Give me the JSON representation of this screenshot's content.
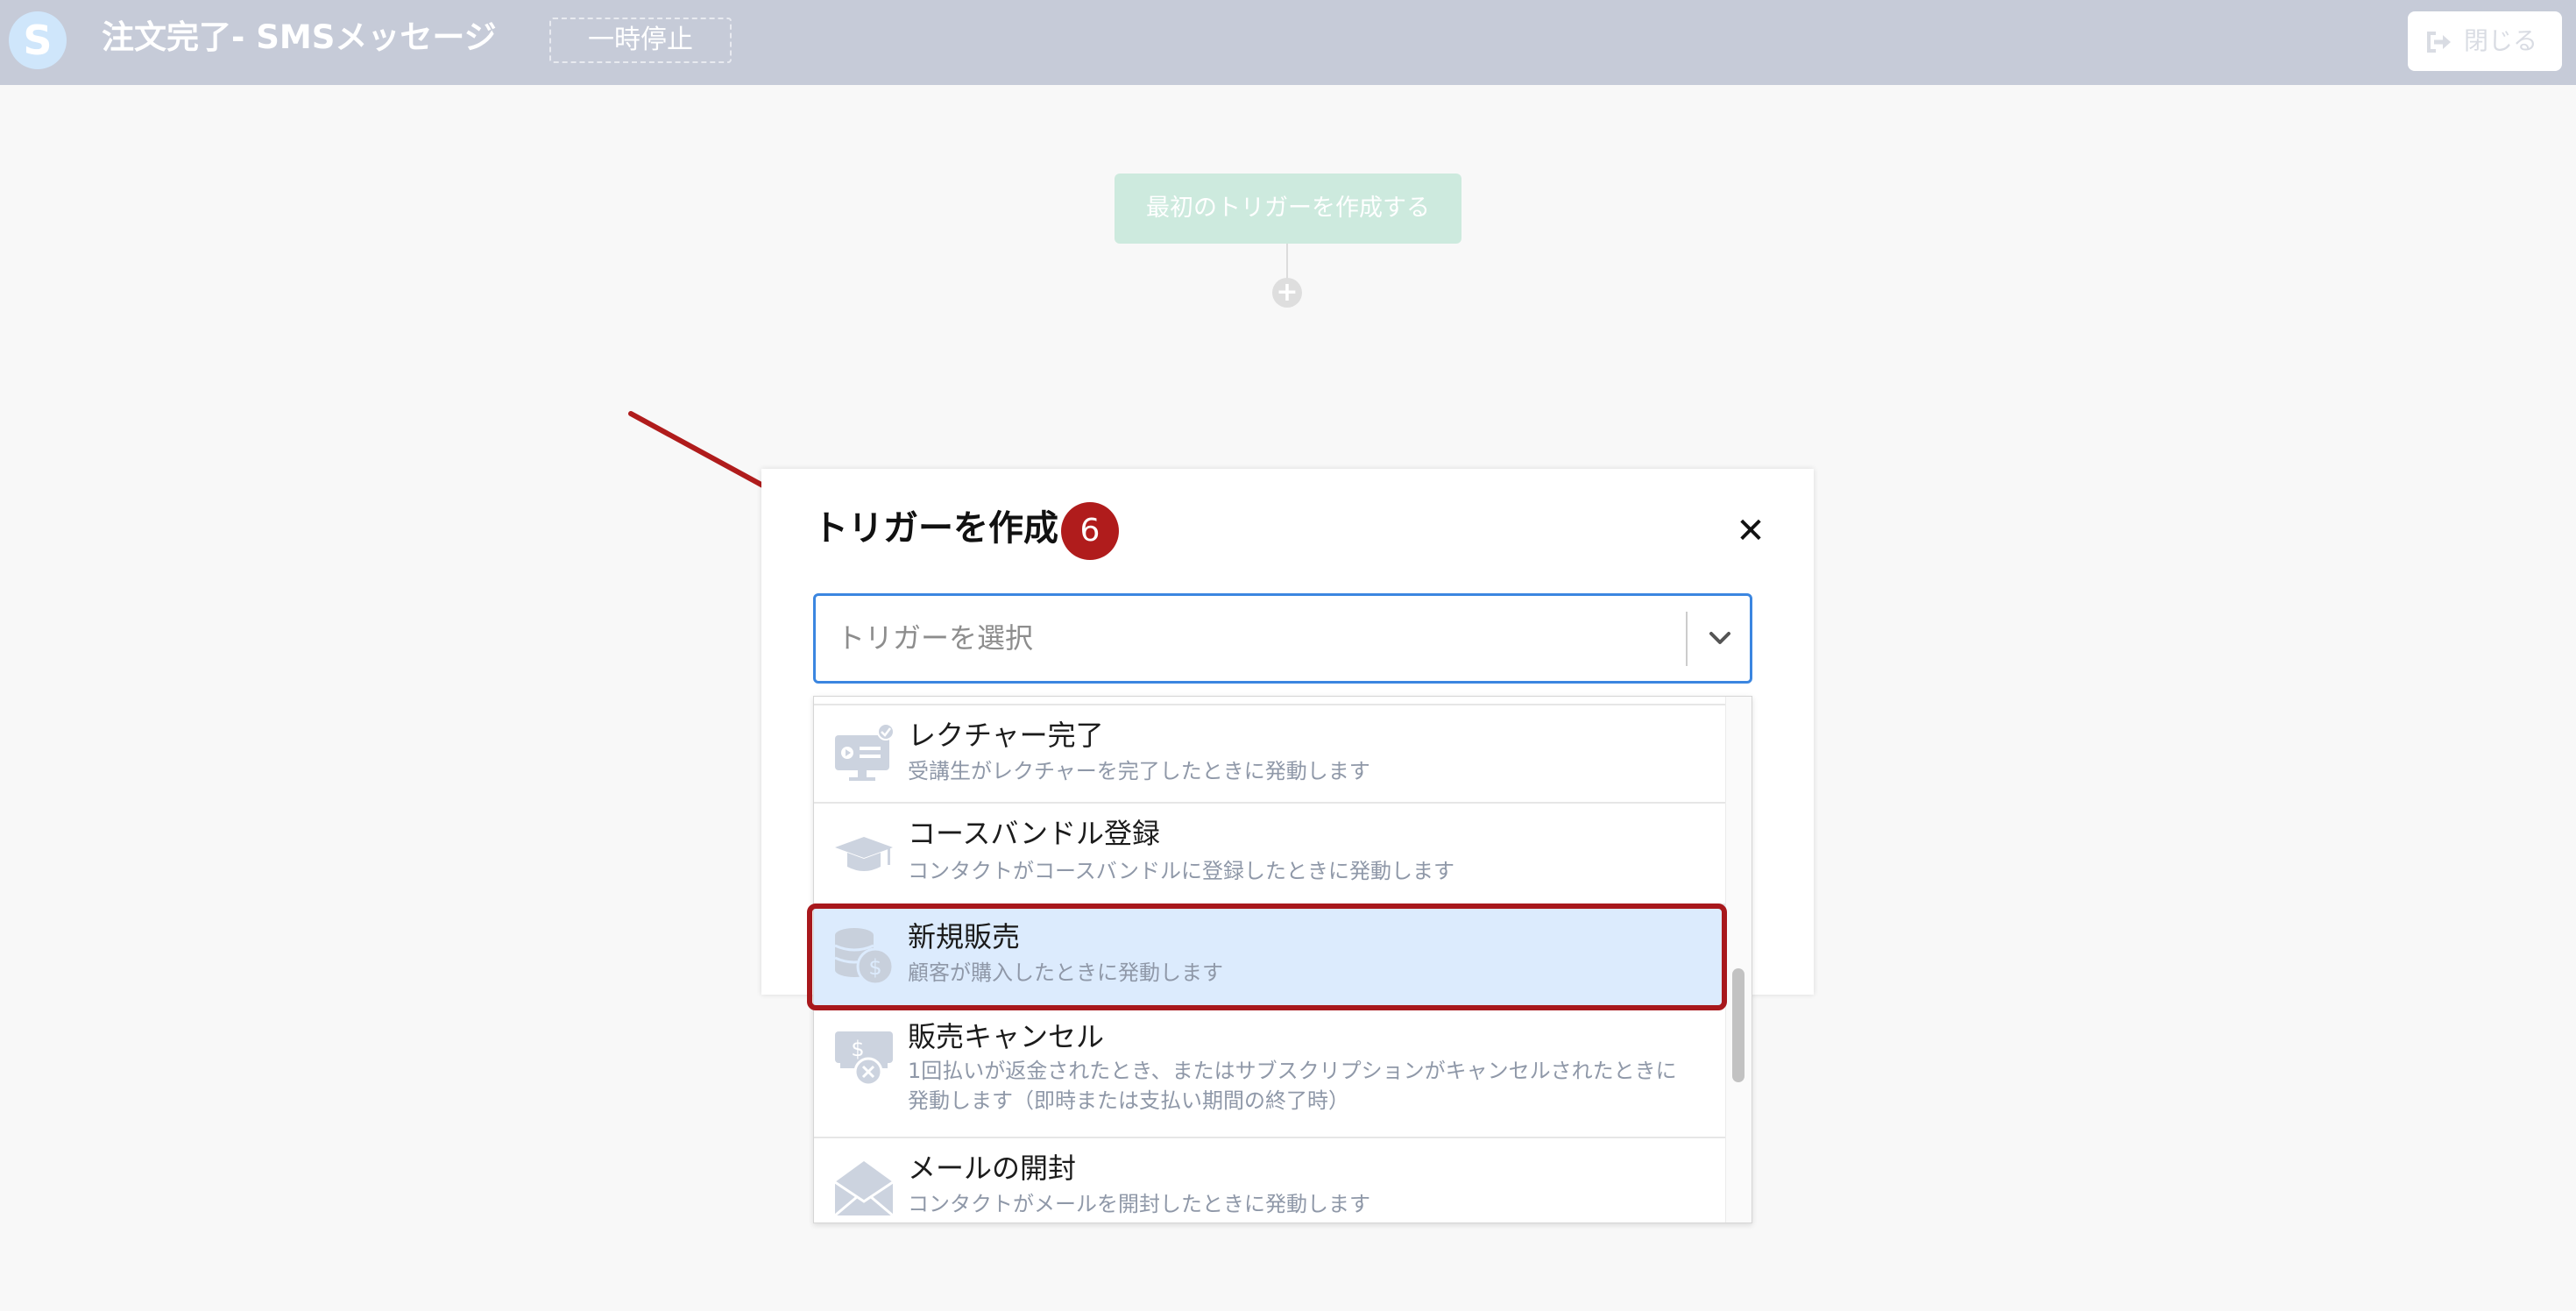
{
  "header": {
    "logo_letter": "S",
    "title": "注文完了- SMSメッセージ",
    "pause_label": "一時停止",
    "close_label": "閉じる",
    "close_icon": "sign-out-icon"
  },
  "canvas": {
    "first_trigger_label": "最初のトリガーを作成する",
    "add_node_symbol": "+"
  },
  "modal": {
    "title": "トリガーを作成",
    "step_number": "6",
    "close_symbol": "✕",
    "select_placeholder": "トリガーを選択"
  },
  "dropdown": {
    "items": [
      {
        "title": "レクチャー完了",
        "description": "受講生がレクチャーを完了したときに発動します",
        "icon": "lecture-complete-icon"
      },
      {
        "title": "コースバンドル登録",
        "description": "コンタクトがコースバンドルに登録したときに発動します",
        "icon": "graduation-cap-icon"
      },
      {
        "title": "新規販売",
        "description": "顧客が購入したときに発動します",
        "icon": "coins-icon",
        "selected": true
      },
      {
        "title": "販売キャンセル",
        "description": "1回払いが返金されたとき、またはサブスクリプションがキャンセルされたときに発動します（即時または支払い期間の終了時）",
        "icon": "cancel-sale-icon"
      },
      {
        "title": "メールの開封",
        "description": "コンタクトがメールを開封したときに発動します",
        "icon": "envelope-icon"
      }
    ]
  },
  "colors": {
    "header_bg": "#c6cbd8",
    "accent_blue": "#3b86e0",
    "highlight_red": "#a8181c",
    "selected_bg": "#dcebfd",
    "trigger_green": "#cdeade"
  }
}
